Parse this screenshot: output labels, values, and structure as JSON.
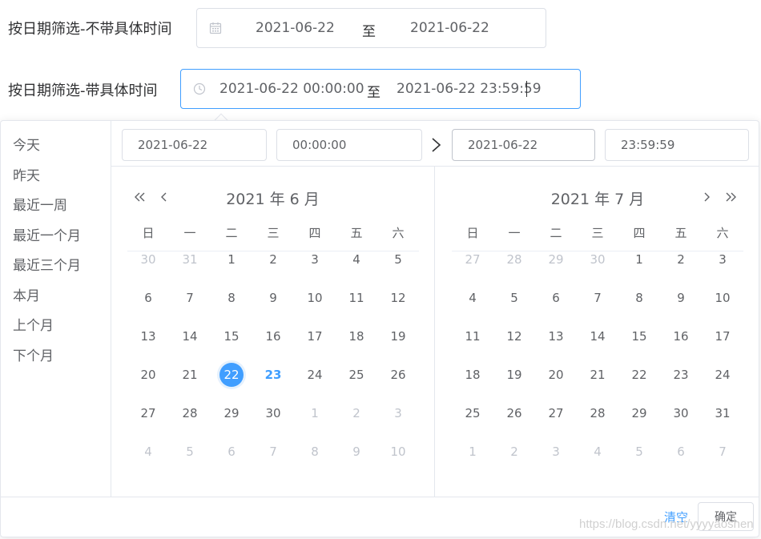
{
  "filters": [
    {
      "label": "按日期筛选-不带具体时间",
      "start": "2021-06-22",
      "separator": "至",
      "end": "2021-06-22",
      "icon": "calendar-icon"
    },
    {
      "label": "按日期筛选-带具体时间",
      "start": "2021-06-22 00:00:00",
      "separator": "至",
      "end": "2021-06-22 23:59:59",
      "icon": "clock-icon"
    }
  ],
  "picker": {
    "shortcuts": [
      "今天",
      "昨天",
      "最近一周",
      "最近一个月",
      "最近三个月",
      "本月",
      "上个月",
      "下个月"
    ],
    "header": {
      "start_date": "2021-06-22",
      "start_time": "00:00:00",
      "end_date": "2021-06-22",
      "end_time": "23:59:59"
    },
    "weekdays": [
      "日",
      "一",
      "二",
      "三",
      "四",
      "五",
      "六"
    ],
    "left": {
      "title": "2021 年 6 月",
      "days": [
        [
          "30",
          "31",
          "1",
          "2",
          "3",
          "4",
          "5"
        ],
        [
          "6",
          "7",
          "8",
          "9",
          "10",
          "11",
          "12"
        ],
        [
          "13",
          "14",
          "15",
          "16",
          "17",
          "18",
          "19"
        ],
        [
          "20",
          "21",
          "22",
          "23",
          "24",
          "25",
          "26"
        ],
        [
          "27",
          "28",
          "29",
          "30",
          "1",
          "2",
          "3"
        ],
        [
          "4",
          "5",
          "6",
          "7",
          "8",
          "9",
          "10"
        ]
      ],
      "lead_muted": 2,
      "trail_muted_from": 32,
      "selected": "22",
      "today": "23"
    },
    "right": {
      "title": "2021 年 7 月",
      "days": [
        [
          "27",
          "28",
          "29",
          "30",
          "1",
          "2",
          "3"
        ],
        [
          "4",
          "5",
          "6",
          "7",
          "8",
          "9",
          "10"
        ],
        [
          "11",
          "12",
          "13",
          "14",
          "15",
          "16",
          "17"
        ],
        [
          "18",
          "19",
          "20",
          "21",
          "22",
          "23",
          "24"
        ],
        [
          "25",
          "26",
          "27",
          "28",
          "29",
          "30",
          "31"
        ],
        [
          "1",
          "2",
          "3",
          "4",
          "5",
          "6",
          "7"
        ]
      ],
      "lead_muted": 4,
      "trail_muted_from": 35
    },
    "footer": {
      "clear": "清空",
      "confirm": "确定"
    }
  },
  "watermark": "https://blog.csdn.net/yyyyaoshen",
  "colors": {
    "accent": "#409eff",
    "text": "#606266",
    "muted": "#c0c4cc",
    "border": "#dcdfe6"
  }
}
